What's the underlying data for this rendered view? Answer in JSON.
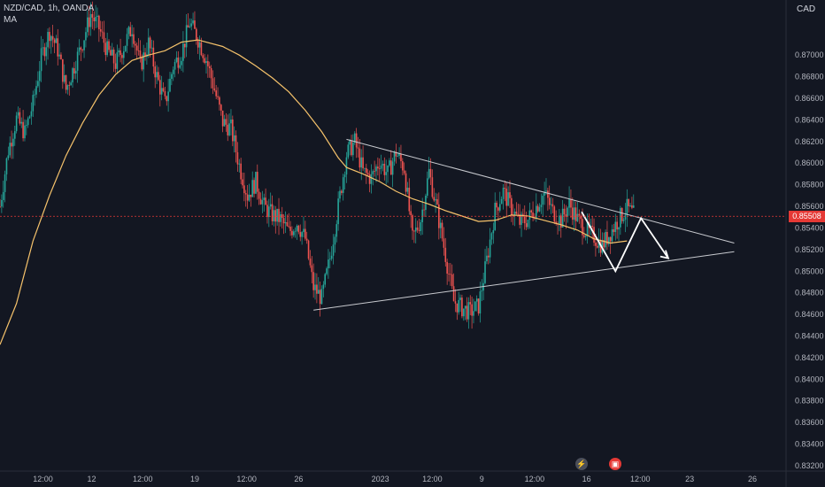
{
  "header": {
    "symbol_line": "NZD/CAD, 1h, OANDA",
    "indicator_label": "MA",
    "currency": "CAD"
  },
  "current_price": {
    "label": "0.85508",
    "value": 0.85508,
    "color": "#e53935"
  },
  "colors": {
    "background": "#131722",
    "up": "#26a69a",
    "down": "#ef5350",
    "ma": "#f5c26b",
    "drawing": "#ffffff"
  },
  "icons": {
    "flash": "flash-icon",
    "calendar": "calendar-event-icon"
  },
  "chart_data": {
    "type": "candlestick",
    "symbol": "NZD/CAD",
    "timeframe": "1h",
    "source": "OANDA",
    "ylim": [
      0.8315,
      0.8751
    ],
    "y_ticks": [
      "0.87000",
      "0.86800",
      "0.86600",
      "0.86400",
      "0.86200",
      "0.86000",
      "0.85800",
      "0.85600",
      "0.85400",
      "0.85200",
      "0.85000",
      "0.84800",
      "0.84600",
      "0.84400",
      "0.84200",
      "0.84000",
      "0.83800",
      "0.83600",
      "0.83400",
      "0.83200"
    ],
    "x_ticks": [
      "12:00",
      "12",
      "12:00",
      "19",
      "12:00",
      "26",
      "2023",
      "12:00",
      "9",
      "12:00",
      "16",
      "12:00",
      "23",
      "26"
    ],
    "x_index_range": [
      0,
      100
    ],
    "x_tick_positions": [
      5.2,
      11.1,
      17.3,
      23.6,
      29.9,
      36.2,
      46.1,
      52.4,
      58.4,
      64.8,
      71.1,
      77.6,
      83.6,
      91.2
    ],
    "price_path": [
      [
        0,
        0.856
      ],
      [
        1,
        0.8612
      ],
      [
        2,
        0.8641
      ],
      [
        3,
        0.8628
      ],
      [
        4,
        0.8655
      ],
      [
        5,
        0.8698
      ],
      [
        6,
        0.8722
      ],
      [
        7,
        0.8705
      ],
      [
        8,
        0.8668
      ],
      [
        9,
        0.869
      ],
      [
        10,
        0.8712
      ],
      [
        11,
        0.8738
      ],
      [
        12,
        0.8725
      ],
      [
        13,
        0.8704
      ],
      [
        14,
        0.8692
      ],
      [
        15,
        0.8708
      ],
      [
        16,
        0.8726
      ],
      [
        17,
        0.869
      ],
      [
        18,
        0.8711
      ],
      [
        19,
        0.868
      ],
      [
        20,
        0.8655
      ],
      [
        21,
        0.869
      ],
      [
        22,
        0.8702
      ],
      [
        23,
        0.873
      ],
      [
        24,
        0.8715
      ],
      [
        25,
        0.8696
      ],
      [
        26,
        0.8668
      ],
      [
        27,
        0.8638
      ],
      [
        28,
        0.8632
      ],
      [
        29,
        0.8598
      ],
      [
        30,
        0.857
      ],
      [
        31,
        0.8583
      ],
      [
        32,
        0.856
      ],
      [
        33,
        0.8552
      ],
      [
        34,
        0.8548
      ],
      [
        35,
        0.8536
      ],
      [
        36,
        0.8545
      ],
      [
        37,
        0.853
      ],
      [
        38,
        0.8485
      ],
      [
        39,
        0.8475
      ],
      [
        40,
        0.8512
      ],
      [
        41,
        0.856
      ],
      [
        42,
        0.8608
      ],
      [
        43,
        0.862
      ],
      [
        44,
        0.8592
      ],
      [
        45,
        0.8586
      ],
      [
        46,
        0.8602
      ],
      [
        47,
        0.859
      ],
      [
        48,
        0.861
      ],
      [
        49,
        0.8595
      ],
      [
        50,
        0.853
      ],
      [
        51,
        0.8548
      ],
      [
        52,
        0.8592
      ],
      [
        53,
        0.8555
      ],
      [
        54,
        0.8515
      ],
      [
        55,
        0.8472
      ],
      [
        56,
        0.8466
      ],
      [
        57,
        0.8462
      ],
      [
        58,
        0.8468
      ],
      [
        59,
        0.851
      ],
      [
        60,
        0.8556
      ],
      [
        61,
        0.8574
      ],
      [
        62,
        0.8558
      ],
      [
        63,
        0.8545
      ],
      [
        64,
        0.8548
      ],
      [
        65,
        0.856
      ],
      [
        66,
        0.8572
      ],
      [
        67,
        0.8555
      ],
      [
        68,
        0.8547
      ],
      [
        69,
        0.8562
      ],
      [
        70,
        0.8548
      ],
      [
        71,
        0.8538
      ],
      [
        72,
        0.8532
      ],
      [
        73,
        0.8524
      ],
      [
        74,
        0.8536
      ],
      [
        75,
        0.8548
      ],
      [
        76,
        0.8558
      ],
      [
        77,
        0.8551
      ]
    ],
    "moving_average": [
      [
        0,
        0.8432
      ],
      [
        2,
        0.847
      ],
      [
        4,
        0.8528
      ],
      [
        6,
        0.857
      ],
      [
        8,
        0.8607
      ],
      [
        10,
        0.8637
      ],
      [
        12,
        0.8663
      ],
      [
        14,
        0.8682
      ],
      [
        16,
        0.8695
      ],
      [
        18,
        0.87
      ],
      [
        20,
        0.8704
      ],
      [
        22,
        0.8712
      ],
      [
        24,
        0.8714
      ],
      [
        25,
        0.8712
      ],
      [
        27,
        0.8708
      ],
      [
        29,
        0.87
      ],
      [
        31,
        0.869
      ],
      [
        33,
        0.8679
      ],
      [
        35,
        0.8666
      ],
      [
        37,
        0.8649
      ],
      [
        39,
        0.8629
      ],
      [
        41,
        0.8605
      ],
      [
        42,
        0.8596
      ],
      [
        44,
        0.859
      ],
      [
        46,
        0.8583
      ],
      [
        48,
        0.8574
      ],
      [
        50,
        0.8567
      ],
      [
        52,
        0.8562
      ],
      [
        54,
        0.8556
      ],
      [
        56,
        0.8551
      ],
      [
        58,
        0.8546
      ],
      [
        60,
        0.8547
      ],
      [
        62,
        0.8552
      ],
      [
        64,
        0.8551
      ],
      [
        66,
        0.8547
      ],
      [
        68,
        0.8543
      ],
      [
        70,
        0.8538
      ],
      [
        72,
        0.853
      ],
      [
        74,
        0.8526
      ],
      [
        76,
        0.8528
      ]
    ],
    "trendlines": [
      {
        "from": [
          42,
          0.8622
        ],
        "to": [
          89,
          0.8526
        ]
      },
      {
        "from": [
          38,
          0.8464
        ],
        "to": [
          89,
          0.8518
        ]
      }
    ],
    "projection_path": [
      [
        70.5,
        0.8555
      ],
      [
        74.6,
        0.85
      ],
      [
        77.7,
        0.8549
      ],
      [
        81,
        0.8512
      ]
    ],
    "last_price": 0.85508
  }
}
